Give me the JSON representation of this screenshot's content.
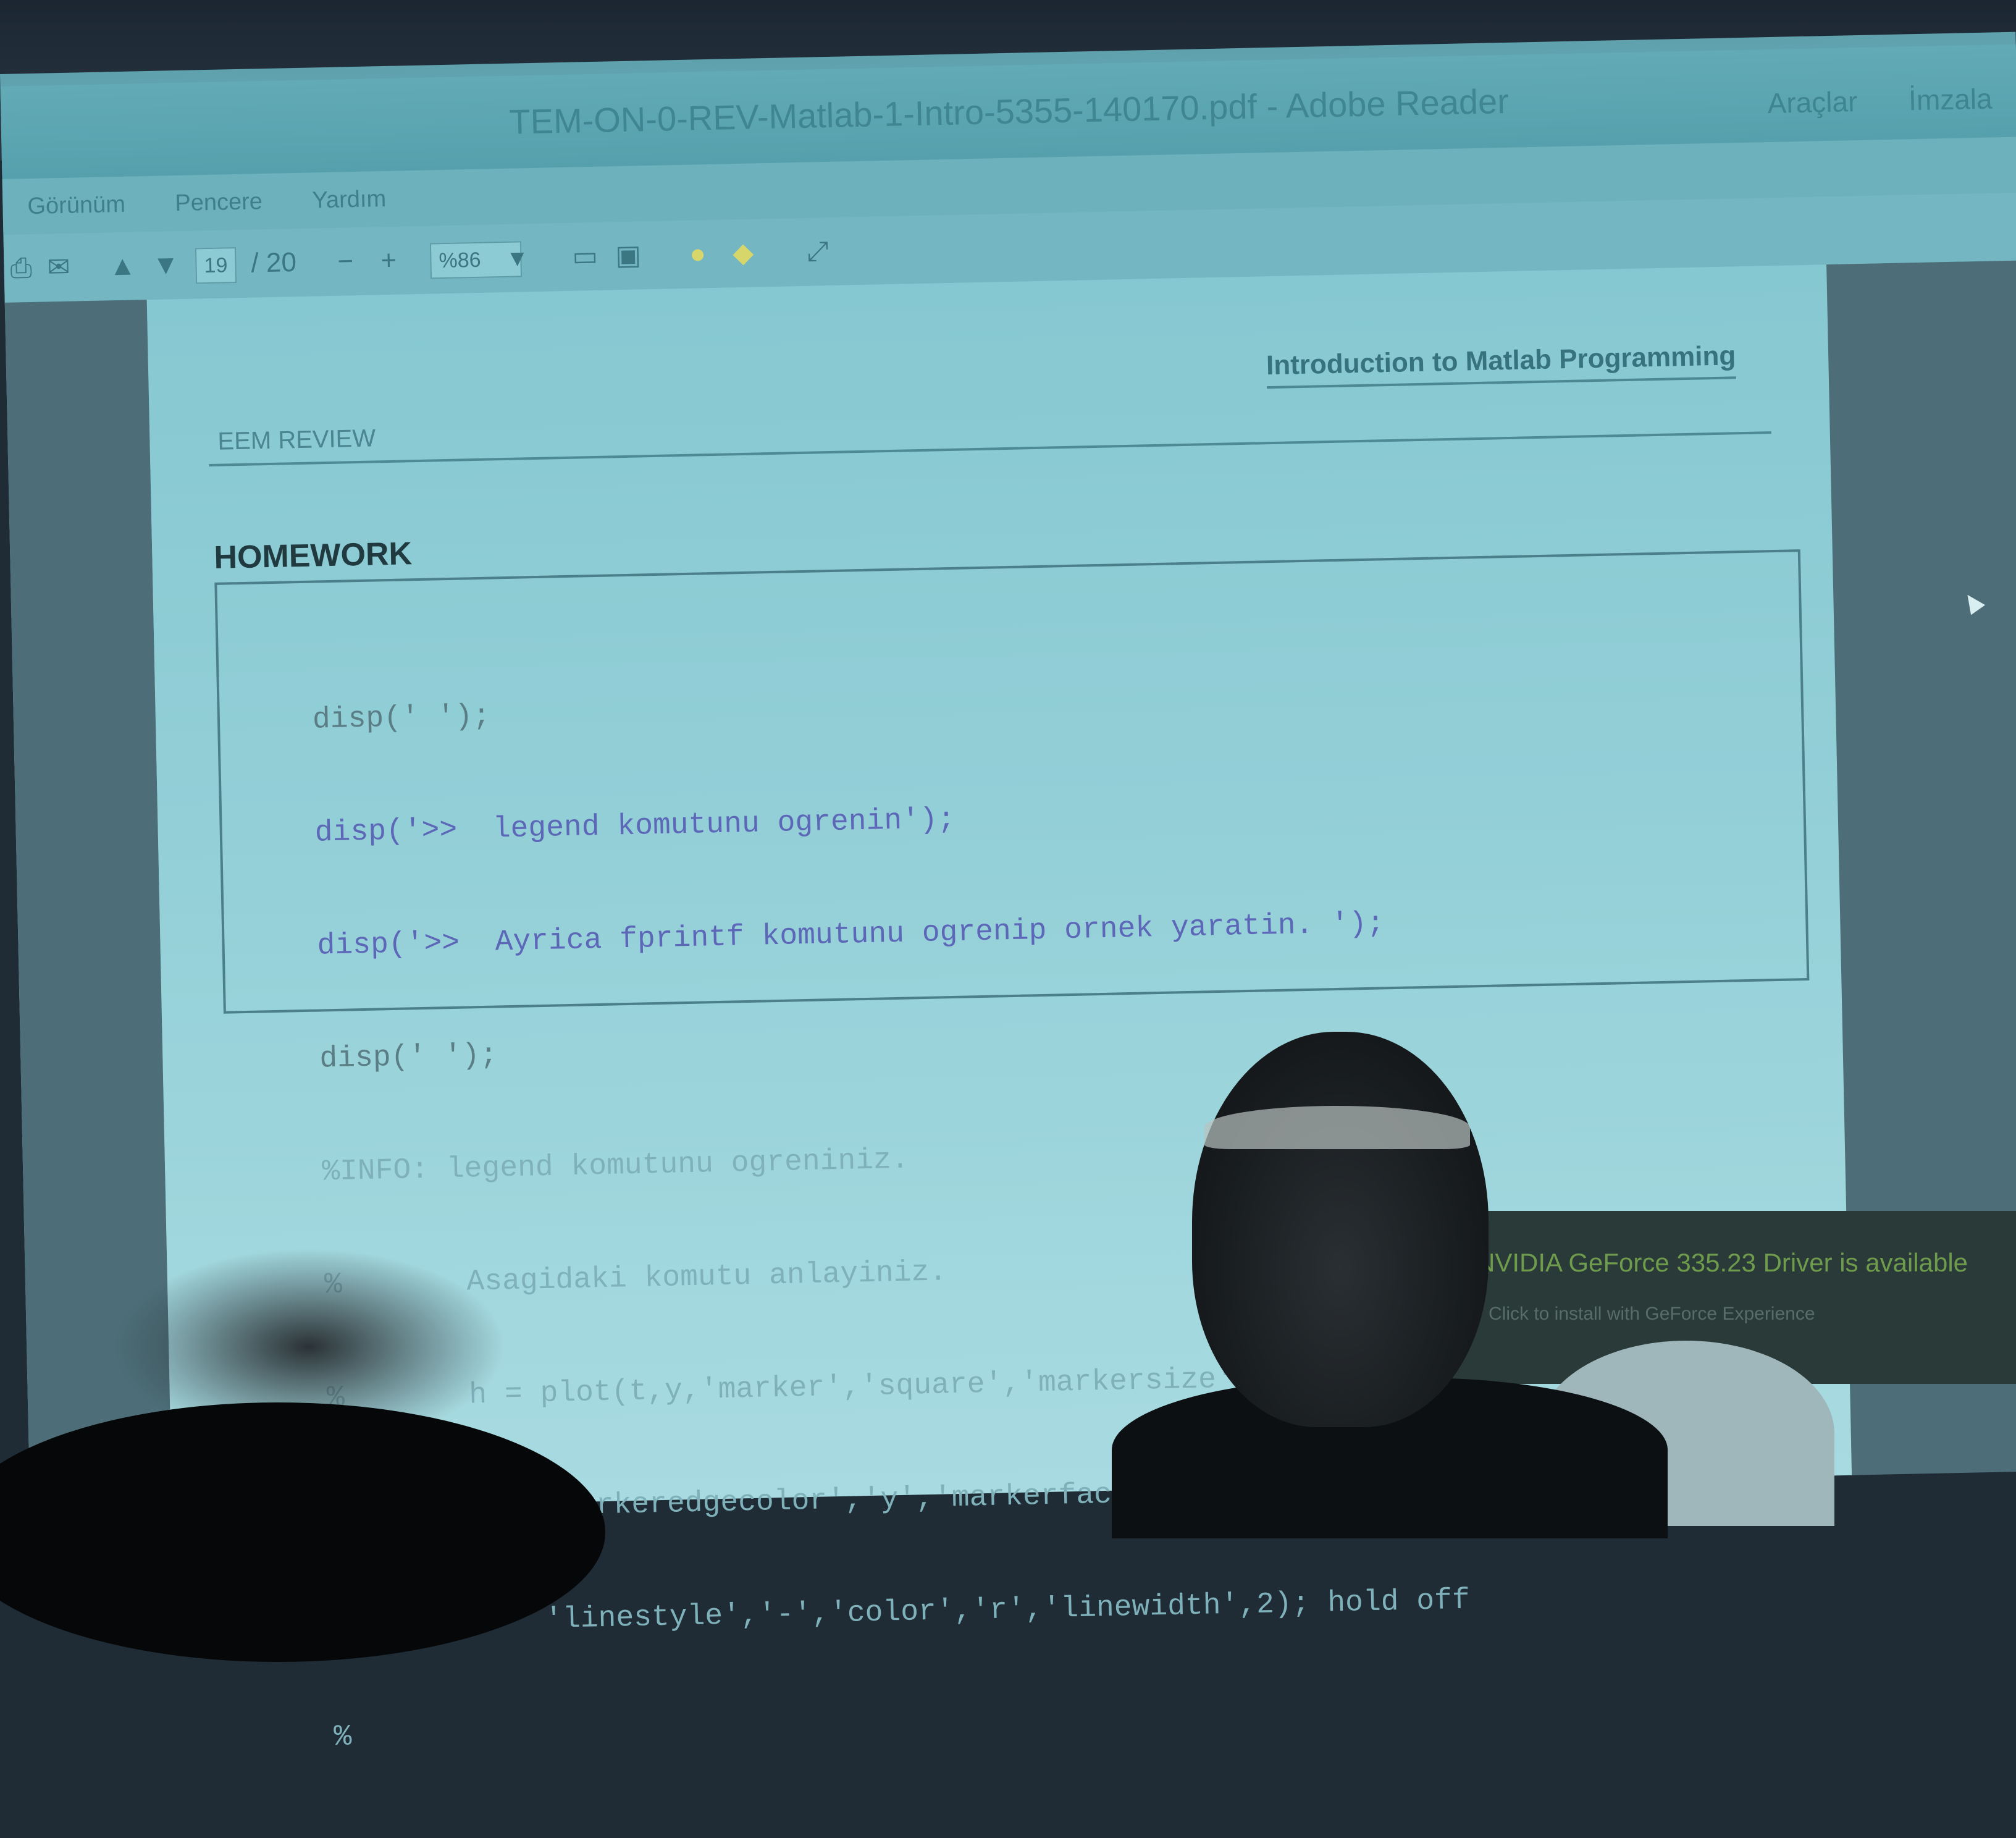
{
  "window": {
    "title": "TEM-ON-0-REV-Matlab-1-Intro-5355-140170.pdf - Adobe Reader",
    "right_links": [
      "Araçlar",
      "İmzala"
    ]
  },
  "menubar": {
    "items": [
      "Görünüm",
      "Pencere",
      "Yardım"
    ]
  },
  "toolbar": {
    "page_current": "19",
    "page_total": "/ 20",
    "zoom_minus": "−",
    "zoom_plus": "+",
    "zoom_value": "%86"
  },
  "document": {
    "header_right": "Introduction to Matlab Programming",
    "header_left": "EEM  REVIEW",
    "section_title": "HOMEWORK",
    "code_lines": [
      "disp(' ');",
      "disp('>>  legend komutunu ogrenin');",
      "disp('>>  Ayrica fprintf komutunu ogrenip ornek yaratin. ');",
      "disp(' ');",
      "%INFO: legend komutunu ogreniniz.",
      "%       Asagidaki komutu anlayiniz.",
      "%       h = plot(t,y,'marker','square','markersize',12,...",
      "%           'markeredgecolor','y','markerfacecolor',[.6 0 .6],...",
      "%           'linestyle','-','color','r','linewidth',2); hold off",
      "%"
    ]
  },
  "notification": {
    "line1": "NVIDIA GeForce 335.23 Driver is available",
    "line2": "Click to install with GeForce Experience"
  },
  "colors": {
    "projection": "#79bac4",
    "code_blue": "#5c67b8",
    "notify_text": "#6f9b4c"
  }
}
